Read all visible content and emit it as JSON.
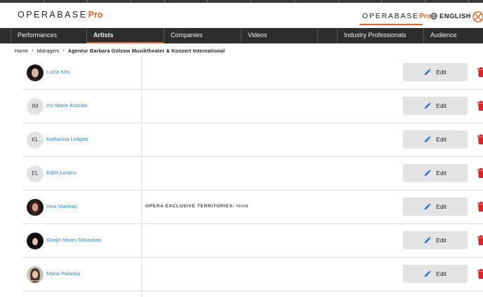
{
  "header": {
    "logo": {
      "text": "OPERABASE",
      "pro": "Pro"
    },
    "pro_button": {
      "text": "OPERABASE",
      "pro": "Pro"
    },
    "language": "ENGLISH"
  },
  "nav": [
    {
      "label": "Performances"
    },
    {
      "label": "Artists",
      "active": true
    },
    {
      "label": "Companies"
    },
    {
      "label": "Videos"
    },
    {
      "label": ""
    },
    {
      "label": "Industry Professionals"
    },
    {
      "label": "Audience"
    }
  ],
  "breadcrumb": {
    "home": "Home",
    "managers": "Managers",
    "current": "Agentur Barbara Gülzow Musiktheater & Konzert International"
  },
  "artists": [
    {
      "name": "Lucia Kim",
      "avatar": "photo",
      "initials": "",
      "territory_label": "",
      "territory_value": "",
      "edit_label": "Edit"
    },
    {
      "name": "Iris Marie Kotzian",
      "avatar": "initials",
      "initials": "IM",
      "territory_label": "",
      "territory_value": "",
      "edit_label": "Edit"
    },
    {
      "name": "Katharina Leitgeb",
      "avatar": "initials",
      "initials": "KL",
      "territory_label": "",
      "territory_value": "",
      "edit_label": "Edit"
    },
    {
      "name": "Edith Lorans",
      "avatar": "initials",
      "initials": "EL",
      "territory_label": "",
      "territory_value": "",
      "edit_label": "Edit"
    },
    {
      "name": "Irina Marinaş",
      "avatar": "photo",
      "initials": "",
      "territory_label": "OPERA EXCLUSIVE TERRITORIES:",
      "territory_value": "World",
      "edit_label": "Edit"
    },
    {
      "name": "Soojin Moon-Sebastian",
      "avatar": "photo",
      "initials": "",
      "territory_label": "",
      "territory_value": "",
      "edit_label": "Edit"
    },
    {
      "name": "Maria Palaska",
      "avatar": "photo",
      "initials": "",
      "territory_label": "",
      "territory_value": "",
      "edit_label": "Edit"
    }
  ],
  "colors": {
    "accent": "#e8622c",
    "link": "#2f86d6",
    "nav_bg": "#2d2d2d",
    "delete": "#d9262c",
    "button_bg": "#e3e3e3"
  }
}
